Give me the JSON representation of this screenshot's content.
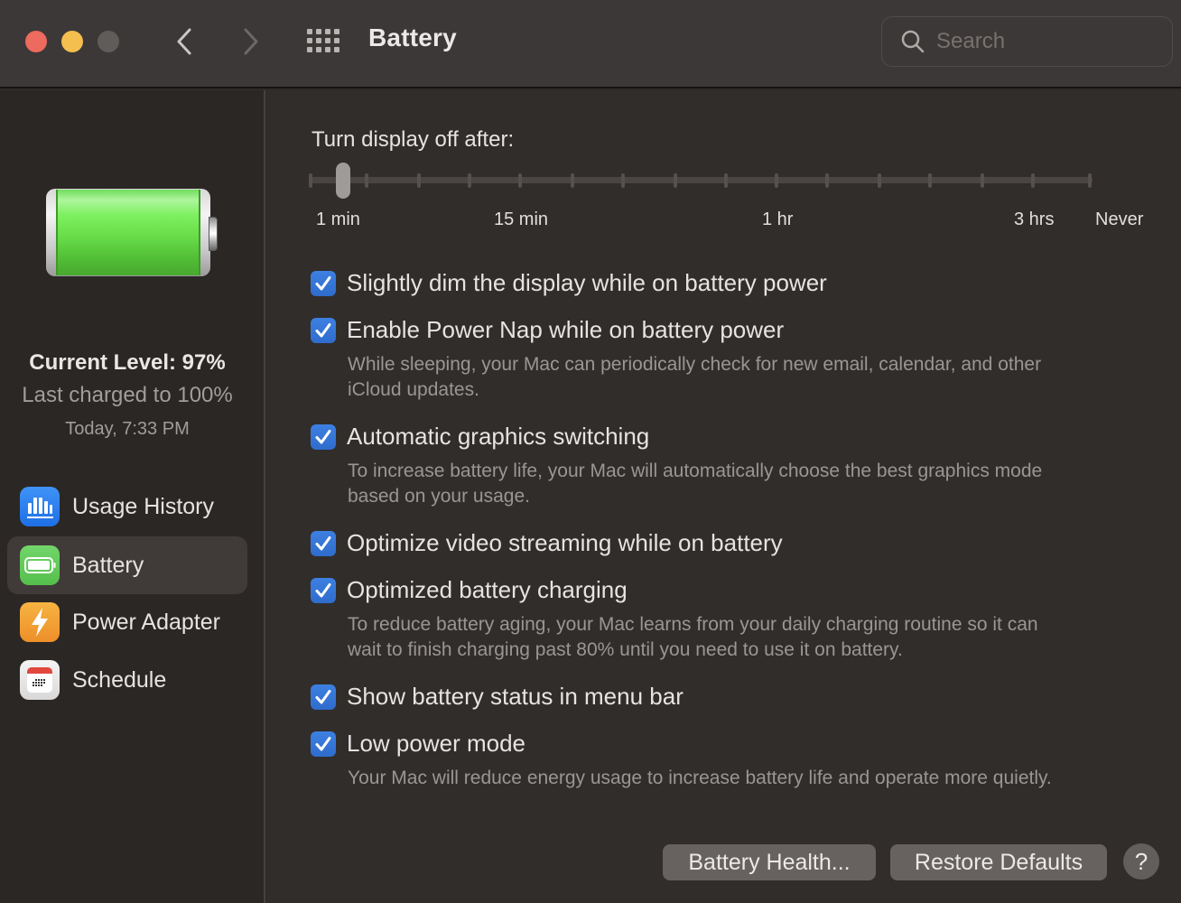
{
  "window": {
    "title": "Battery",
    "search_placeholder": "Search",
    "search_value": ""
  },
  "sidebar": {
    "battery_level_percent": 97,
    "current_level": "Current Level: 97%",
    "last_charged": "Last charged to 100%",
    "last_charged_time": "Today, 7:33 PM",
    "items": [
      {
        "label": "Usage History",
        "icon": "bar-chart-icon",
        "active": false
      },
      {
        "label": "Battery",
        "icon": "battery-icon",
        "active": true
      },
      {
        "label": "Power Adapter",
        "icon": "lightning-icon",
        "active": false
      },
      {
        "label": "Schedule",
        "icon": "calendar-icon",
        "active": false
      }
    ]
  },
  "main": {
    "display_off": {
      "label": "Turn display off after:",
      "tick_labels": [
        "1 min",
        "15 min",
        "1 hr",
        "3 hrs",
        "Never"
      ],
      "tick_count": 16,
      "selected_index": 0,
      "selected_value": "1 min"
    },
    "options": [
      {
        "label": "Slightly dim the display while on battery power",
        "checked": true,
        "description": ""
      },
      {
        "label": "Enable Power Nap while on battery power",
        "checked": true,
        "description_lines": [
          "While sleeping, your Mac can periodically check for new email, calendar, and other",
          "iCloud updates."
        ]
      },
      {
        "label": "Automatic graphics switching",
        "checked": true,
        "description_lines": [
          "To increase battery life, your Mac will automatically choose the best graphics mode",
          "based on your usage."
        ]
      },
      {
        "label": "Optimize video streaming while on battery",
        "checked": true,
        "description": ""
      },
      {
        "label": "Optimized battery charging",
        "checked": true,
        "description_lines": [
          "To reduce battery aging, your Mac learns from your daily charging routine so it can",
          "wait to finish charging past 80% until you need to use it on battery."
        ]
      },
      {
        "label": "Show battery status in menu bar",
        "checked": true,
        "description": ""
      },
      {
        "label": "Low power mode",
        "checked": true,
        "description_lines": [
          "Your Mac will reduce energy usage to increase battery life and operate more quietly."
        ]
      }
    ],
    "buttons": {
      "battery_health": "Battery Health...",
      "restore_defaults": "Restore Defaults",
      "help": "?"
    }
  }
}
